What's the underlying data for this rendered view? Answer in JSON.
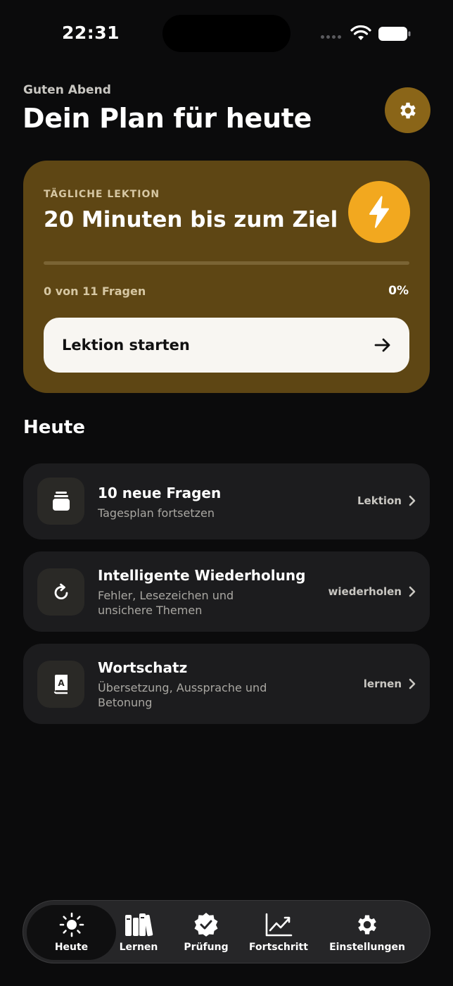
{
  "status_bar": {
    "time": "22:31"
  },
  "header": {
    "greeting": "Guten Abend",
    "title": "Dein Plan für heute",
    "settings_icon": "gear-icon"
  },
  "daily_card": {
    "kicker": "TÄGLICHE LEKTION",
    "title": "20 Minuten bis zum Ziel",
    "icon": "bolt-icon",
    "progress_fraction": 0,
    "progress_text": "0 von 11 Fragen",
    "progress_percent": "0%",
    "start_button_label": "Lektion starten",
    "accent_color": "#f2a81f",
    "card_color": "#5e4614"
  },
  "today": {
    "section_title": "Heute",
    "items": [
      {
        "icon": "stack-icon",
        "title": "10 neue Fragen",
        "subtitle": "Tagesplan fortsetzen",
        "action": "Lektion"
      },
      {
        "icon": "repeat-icon",
        "title": "Intelligente Wiederholung",
        "subtitle": "Fehler, Lesezeichen und unsichere Themen",
        "action": "wiederholen"
      },
      {
        "icon": "dictionary-icon",
        "title": "Wortschatz",
        "subtitle": "Übersetzung, Aussprache und Betonung",
        "action": "lernen"
      }
    ]
  },
  "tab_bar": {
    "tabs": [
      {
        "icon": "sun-icon",
        "label": "Heute",
        "active": true
      },
      {
        "icon": "books-icon",
        "label": "Lernen",
        "active": false
      },
      {
        "icon": "badge-check-icon",
        "label": "Prüfung",
        "active": false
      },
      {
        "icon": "chart-icon",
        "label": "Fortschritt",
        "active": false
      },
      {
        "icon": "gear-icon",
        "label": "Einstellungen",
        "active": false
      }
    ]
  }
}
